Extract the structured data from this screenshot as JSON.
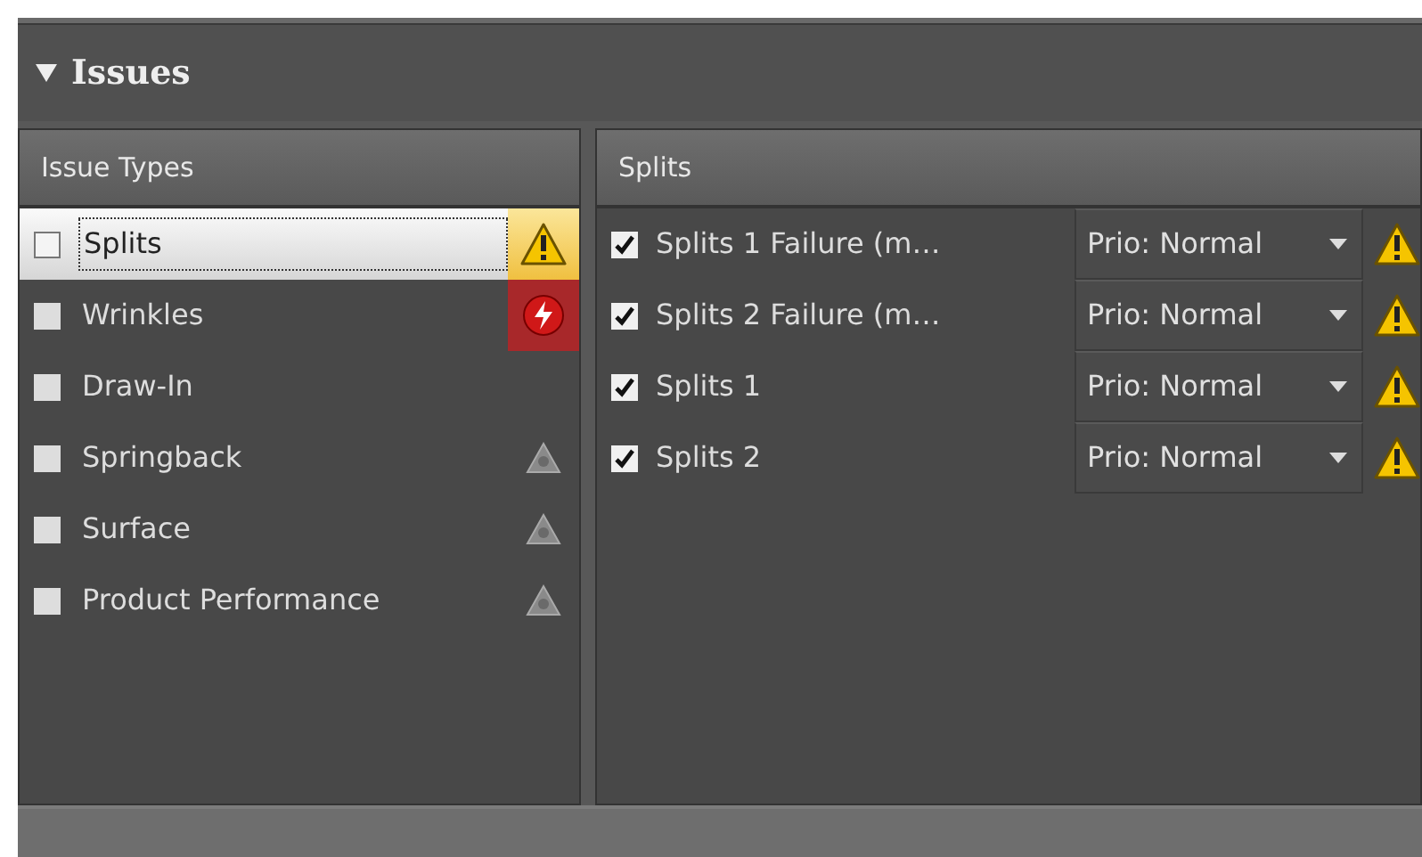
{
  "header": {
    "title": "Issues",
    "expanded": true
  },
  "issue_types": {
    "title": "Issue Types",
    "items": [
      {
        "label": "Splits",
        "checked": false,
        "selected": true,
        "kind": "warning"
      },
      {
        "label": "Wrinkles",
        "checked": false,
        "selected": false,
        "kind": "error"
      },
      {
        "label": "Draw-In",
        "checked": false,
        "selected": false,
        "kind": "plain"
      },
      {
        "label": "Springback",
        "checked": false,
        "selected": false,
        "kind": "unknown"
      },
      {
        "label": "Surface",
        "checked": false,
        "selected": false,
        "kind": "unknown"
      },
      {
        "label": "Product Performance",
        "checked": false,
        "selected": false,
        "kind": "unknown"
      }
    ]
  },
  "splits": {
    "title": "Splits",
    "rows": [
      {
        "label": "Splits 1 Failure (m…",
        "checked": true,
        "priority": "Prio: Normal",
        "kind": "warning"
      },
      {
        "label": "Splits 2 Failure (m…",
        "checked": true,
        "priority": "Prio: Normal",
        "kind": "warning"
      },
      {
        "label": "Splits 1",
        "checked": true,
        "priority": "Prio: Normal",
        "kind": "warning"
      },
      {
        "label": "Splits 2",
        "checked": true,
        "priority": "Prio: Normal",
        "kind": "warning"
      }
    ]
  }
}
